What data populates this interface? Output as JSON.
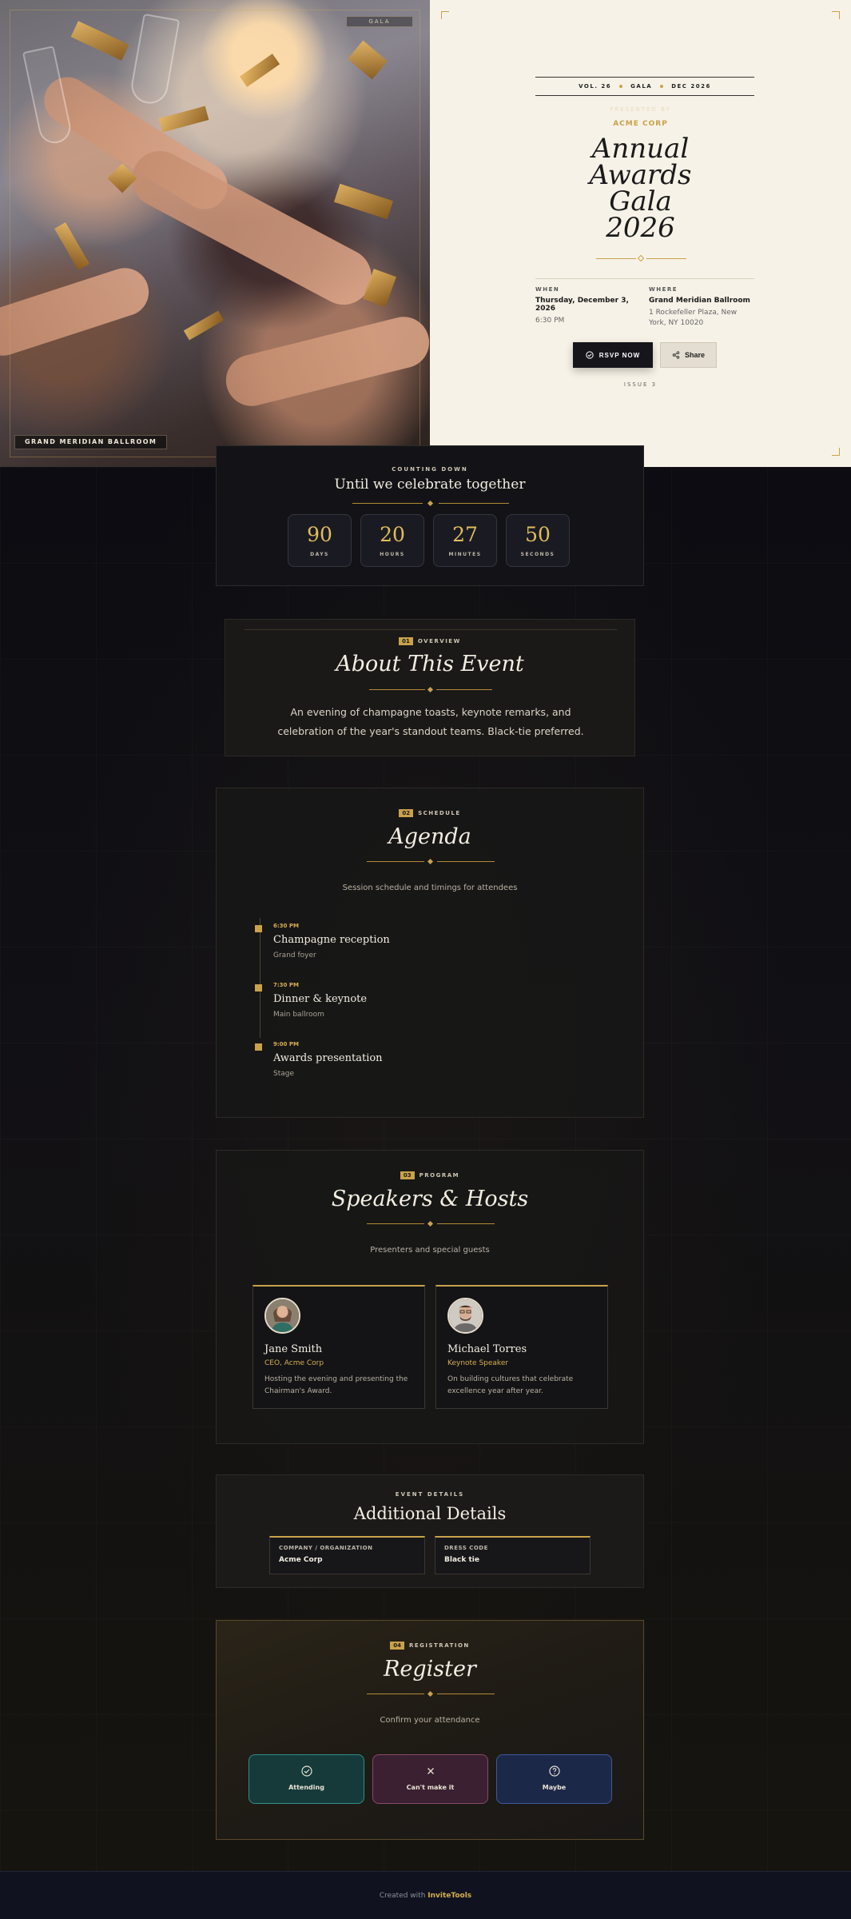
{
  "hero": {
    "gala_tag": "GALA",
    "venue_tag": "GRAND MERIDIAN BALLROOM",
    "issue_bar": {
      "vol": "VOL. 26",
      "kind": "GALA",
      "date": "DEC 2026"
    },
    "presented_by": "PRESENTED BY",
    "host": "ACME CORP",
    "title_lines": [
      "Annual",
      "Awards",
      "Gala",
      "2026"
    ],
    "when": {
      "label": "WHEN",
      "date": "Thursday, December 3, 2026",
      "time": "6:30 PM"
    },
    "where": {
      "label": "WHERE",
      "venue": "Grand Meridian Ballroom",
      "address": "1 Rockefeller Plaza, New York, NY 10020"
    },
    "rsvp_label": "RSVP NOW",
    "share_label": "Share",
    "issue_no": "ISSUE 3"
  },
  "countdown": {
    "caption": "COUNTING DOWN",
    "heading": "Until we celebrate together",
    "units": [
      {
        "value": "90",
        "label": "DAYS"
      },
      {
        "value": "20",
        "label": "HOURS"
      },
      {
        "value": "27",
        "label": "MINUTES"
      },
      {
        "value": "50",
        "label": "SECONDS"
      }
    ]
  },
  "overview": {
    "num": "01",
    "tag": "OVERVIEW",
    "title": "About This Event",
    "text": "An evening of champagne toasts, keynote remarks, and celebration of the year's standout teams. Black-tie preferred."
  },
  "agenda": {
    "num": "02",
    "tag": "SCHEDULE",
    "title": "Agenda",
    "subtitle": "Session schedule and timings for attendees",
    "items": [
      {
        "time": "6:30 PM",
        "name": "Champagne reception",
        "location": "Grand foyer"
      },
      {
        "time": "7:30 PM",
        "name": "Dinner & keynote",
        "location": "Main ballroom"
      },
      {
        "time": "9:00 PM",
        "name": "Awards presentation",
        "location": "Stage"
      }
    ]
  },
  "speakers": {
    "num": "03",
    "tag": "PROGRAM",
    "title": "Speakers & Hosts",
    "subtitle": "Presenters and special guests",
    "people": [
      {
        "name": "Jane Smith",
        "role": "CEO, Acme Corp",
        "desc": "Hosting the evening and presenting the Chairman's Award."
      },
      {
        "name": "Michael Torres",
        "role": "Keynote Speaker",
        "desc": "On building cultures that celebrate excellence year after year."
      }
    ]
  },
  "details": {
    "caption": "EVENT DETAILS",
    "title": "Additional Details",
    "items": [
      {
        "label": "COMPANY / ORGANIZATION",
        "value": "Acme Corp"
      },
      {
        "label": "DRESS CODE",
        "value": "Black tie"
      }
    ]
  },
  "register": {
    "num": "04",
    "tag": "REGISTRATION",
    "title": "Register",
    "subtitle": "Confirm your attendance",
    "options": [
      {
        "label": "Attending",
        "icon": "check-circle-icon",
        "color": "#2f8f8a"
      },
      {
        "label": "Can't make it",
        "icon": "x-icon",
        "color": "#8a4a6a"
      },
      {
        "label": "Maybe",
        "icon": "question-circle-icon",
        "color": "#3d5a9a"
      }
    ]
  },
  "footer": {
    "prefix": "Created with",
    "brand": "InviteTools"
  },
  "colors": {
    "accent": "#c9a24a",
    "card": "#f7f2e7",
    "page": "#0e0e10"
  }
}
